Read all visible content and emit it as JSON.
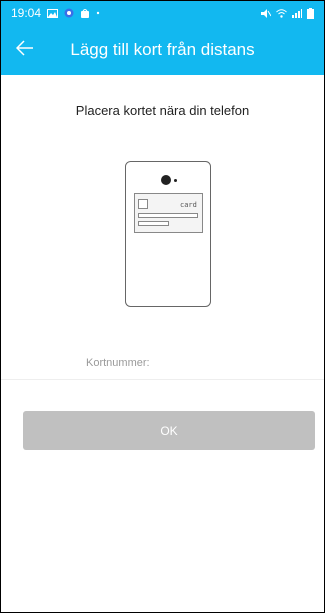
{
  "status_bar": {
    "time": "19:04",
    "icons_left": [
      "image-icon",
      "app-icon",
      "app-icon"
    ],
    "icons_right": [
      "mute-icon",
      "wifi-icon",
      "signal-icon",
      "battery-icon"
    ]
  },
  "header": {
    "title": "Lägg till kort från distans",
    "background": "#12b8f0"
  },
  "main": {
    "instruction": "Placera kortet nära din telefon",
    "illustration_card_text": "card",
    "card_number_label": "Kortnummer:",
    "card_number_value": ""
  },
  "actions": {
    "ok_label": "OK",
    "ok_enabled": false,
    "ok_color": "#c0c0c0"
  }
}
